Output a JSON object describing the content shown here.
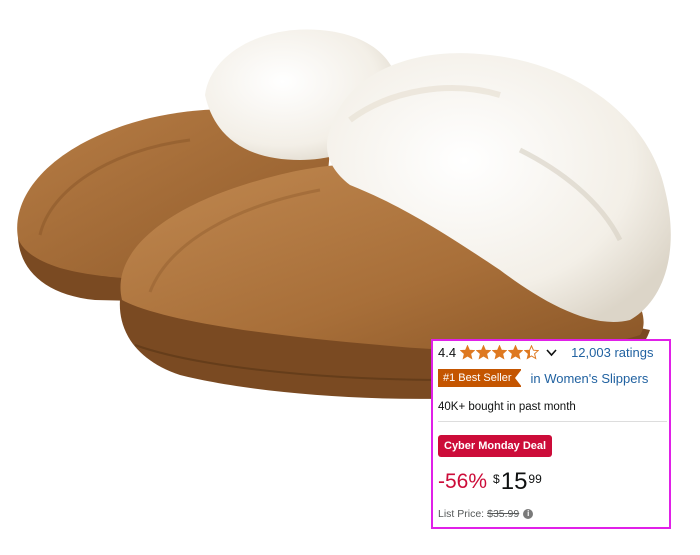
{
  "product_image": {
    "icon": "slipper-photo"
  },
  "rating": {
    "value": "4.4",
    "stars": 4.4,
    "ratings_count": "12,003 ratings",
    "star_color": "#de7921"
  },
  "badge": {
    "label": "#1 Best Seller",
    "category": "in Women's Slippers",
    "color": "#c45500"
  },
  "bought": "40K+ bought in past month",
  "deal": {
    "label": "Cyber Monday Deal",
    "color": "#cc0c39"
  },
  "price": {
    "discount": "-56%",
    "currency": "$",
    "whole": "15",
    "fraction": "99"
  },
  "list_price": {
    "label": "List Price:",
    "value": "$35.99"
  },
  "highlight_color": "#e020e8"
}
